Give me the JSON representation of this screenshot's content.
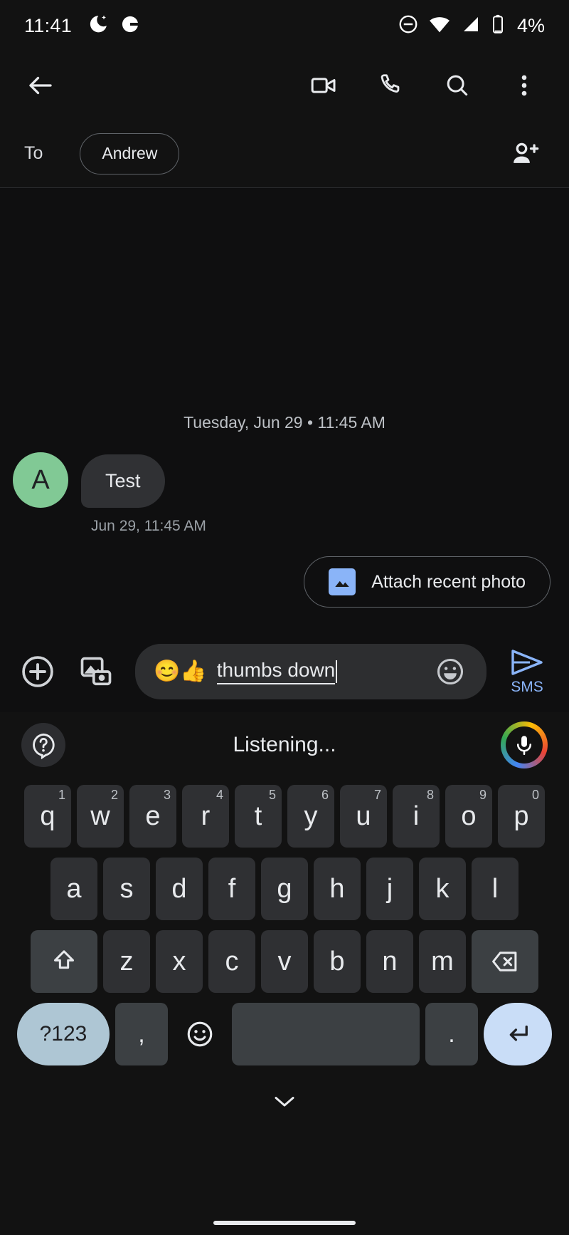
{
  "status_bar": {
    "time": "11:41",
    "battery_percent": "4%",
    "icons": [
      "do-not-disturb-moon-icon",
      "half-circle-icon",
      "minus-circle-icon",
      "wifi-icon",
      "signal-icon",
      "battery-icon"
    ]
  },
  "toolbar": {
    "back_icon": "back-arrow-icon",
    "actions": [
      {
        "name": "video-call-icon"
      },
      {
        "name": "phone-call-icon"
      },
      {
        "name": "search-icon"
      },
      {
        "name": "overflow-menu-icon"
      }
    ]
  },
  "recipient": {
    "to_label": "To",
    "chip_name": "Andrew",
    "add_person_icon": "add-person-icon"
  },
  "conversation": {
    "date_separator": "Tuesday, Jun 29 • 11:45 AM",
    "messages": [
      {
        "avatar_initial": "A",
        "avatar_color": "#81c995",
        "text": "Test",
        "timestamp": "Jun 29, 11:45 AM"
      }
    ]
  },
  "suggestion_chips": [
    {
      "label": "Attach recent photo",
      "icon": "image-icon",
      "icon_color": "#8ab4f8"
    }
  ],
  "compose": {
    "plus_icon": "add-circle-icon",
    "gallery_icon": "gallery-camera-icon",
    "emoji_prefix_1": "😊",
    "emoji_prefix_2": "👍",
    "typed_text": "thumbs down",
    "emoji_button_icon": "emoji-face-icon",
    "send_label": "SMS",
    "send_icon": "send-arrow-icon",
    "send_color": "#8ab4f8"
  },
  "voice": {
    "help_icon": "help-icon",
    "status_text": "Listening...",
    "mic_icon": "microphone-icon"
  },
  "keyboard": {
    "row1": [
      {
        "key": "q",
        "hint": "1"
      },
      {
        "key": "w",
        "hint": "2"
      },
      {
        "key": "e",
        "hint": "3"
      },
      {
        "key": "r",
        "hint": "4"
      },
      {
        "key": "t",
        "hint": "5"
      },
      {
        "key": "y",
        "hint": "6"
      },
      {
        "key": "u",
        "hint": "7"
      },
      {
        "key": "i",
        "hint": "8"
      },
      {
        "key": "o",
        "hint": "9"
      },
      {
        "key": "p",
        "hint": "0"
      }
    ],
    "row2": [
      {
        "key": "a"
      },
      {
        "key": "s"
      },
      {
        "key": "d"
      },
      {
        "key": "f"
      },
      {
        "key": "g"
      },
      {
        "key": "h"
      },
      {
        "key": "j"
      },
      {
        "key": "k"
      },
      {
        "key": "l"
      }
    ],
    "row3": [
      {
        "key": "z"
      },
      {
        "key": "x"
      },
      {
        "key": "c"
      },
      {
        "key": "v"
      },
      {
        "key": "b"
      },
      {
        "key": "n"
      },
      {
        "key": "m"
      }
    ],
    "shift_icon": "shift-arrow-icon",
    "backspace_icon": "backspace-icon",
    "symbols_label": "?123",
    "comma_label": ",",
    "emoji_key_icon": "emoji-key-icon",
    "space_label": "",
    "period_label": ".",
    "enter_icon": "enter-arrow-icon"
  },
  "bottom": {
    "collapse_icon": "chevron-down-icon"
  }
}
